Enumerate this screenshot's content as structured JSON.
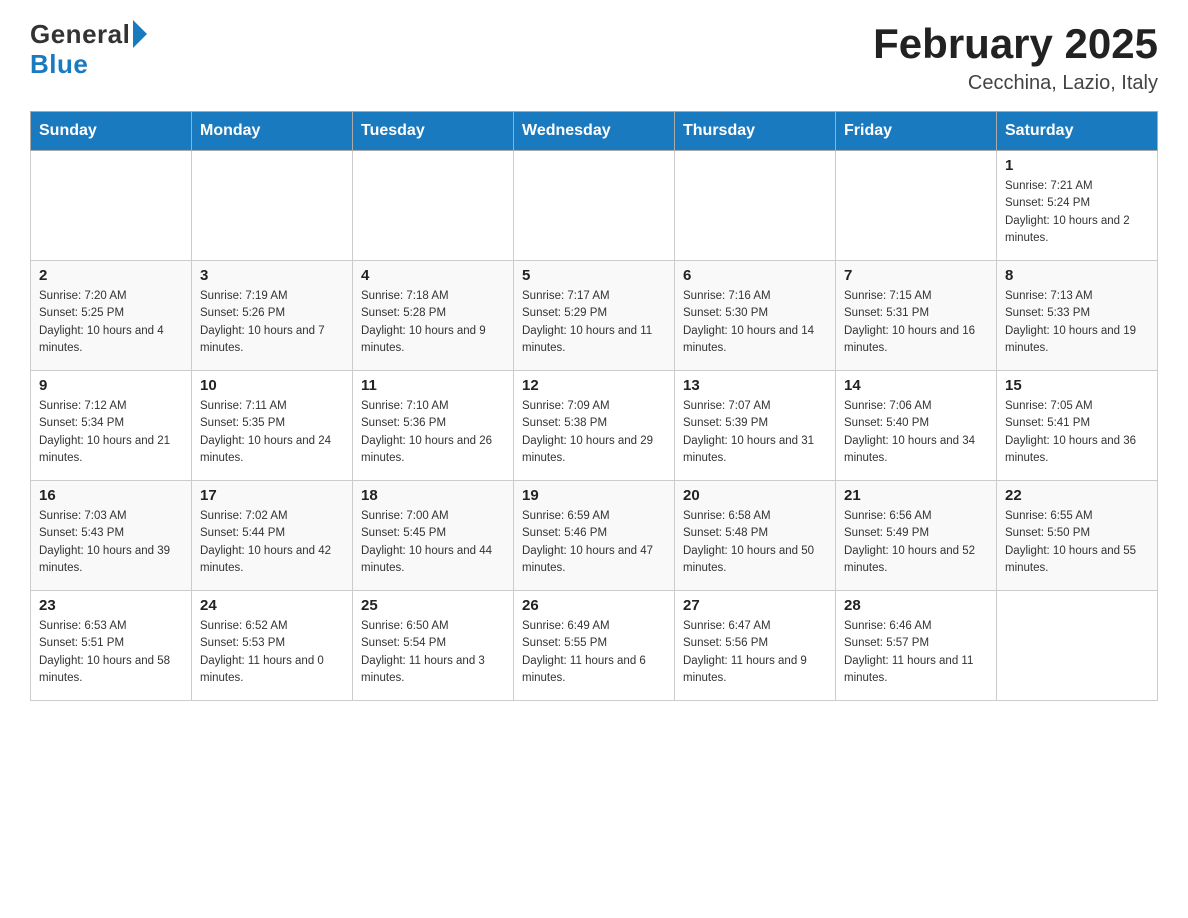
{
  "header": {
    "logo_general": "General",
    "logo_blue": "Blue",
    "month": "February 2025",
    "location": "Cecchina, Lazio, Italy"
  },
  "days_of_week": [
    "Sunday",
    "Monday",
    "Tuesday",
    "Wednesday",
    "Thursday",
    "Friday",
    "Saturday"
  ],
  "weeks": [
    [
      {
        "day": "",
        "sunrise": "",
        "sunset": "",
        "daylight": ""
      },
      {
        "day": "",
        "sunrise": "",
        "sunset": "",
        "daylight": ""
      },
      {
        "day": "",
        "sunrise": "",
        "sunset": "",
        "daylight": ""
      },
      {
        "day": "",
        "sunrise": "",
        "sunset": "",
        "daylight": ""
      },
      {
        "day": "",
        "sunrise": "",
        "sunset": "",
        "daylight": ""
      },
      {
        "day": "",
        "sunrise": "",
        "sunset": "",
        "daylight": ""
      },
      {
        "day": "1",
        "sunrise": "Sunrise: 7:21 AM",
        "sunset": "Sunset: 5:24 PM",
        "daylight": "Daylight: 10 hours and 2 minutes."
      }
    ],
    [
      {
        "day": "2",
        "sunrise": "Sunrise: 7:20 AM",
        "sunset": "Sunset: 5:25 PM",
        "daylight": "Daylight: 10 hours and 4 minutes."
      },
      {
        "day": "3",
        "sunrise": "Sunrise: 7:19 AM",
        "sunset": "Sunset: 5:26 PM",
        "daylight": "Daylight: 10 hours and 7 minutes."
      },
      {
        "day": "4",
        "sunrise": "Sunrise: 7:18 AM",
        "sunset": "Sunset: 5:28 PM",
        "daylight": "Daylight: 10 hours and 9 minutes."
      },
      {
        "day": "5",
        "sunrise": "Sunrise: 7:17 AM",
        "sunset": "Sunset: 5:29 PM",
        "daylight": "Daylight: 10 hours and 11 minutes."
      },
      {
        "day": "6",
        "sunrise": "Sunrise: 7:16 AM",
        "sunset": "Sunset: 5:30 PM",
        "daylight": "Daylight: 10 hours and 14 minutes."
      },
      {
        "day": "7",
        "sunrise": "Sunrise: 7:15 AM",
        "sunset": "Sunset: 5:31 PM",
        "daylight": "Daylight: 10 hours and 16 minutes."
      },
      {
        "day": "8",
        "sunrise": "Sunrise: 7:13 AM",
        "sunset": "Sunset: 5:33 PM",
        "daylight": "Daylight: 10 hours and 19 minutes."
      }
    ],
    [
      {
        "day": "9",
        "sunrise": "Sunrise: 7:12 AM",
        "sunset": "Sunset: 5:34 PM",
        "daylight": "Daylight: 10 hours and 21 minutes."
      },
      {
        "day": "10",
        "sunrise": "Sunrise: 7:11 AM",
        "sunset": "Sunset: 5:35 PM",
        "daylight": "Daylight: 10 hours and 24 minutes."
      },
      {
        "day": "11",
        "sunrise": "Sunrise: 7:10 AM",
        "sunset": "Sunset: 5:36 PM",
        "daylight": "Daylight: 10 hours and 26 minutes."
      },
      {
        "day": "12",
        "sunrise": "Sunrise: 7:09 AM",
        "sunset": "Sunset: 5:38 PM",
        "daylight": "Daylight: 10 hours and 29 minutes."
      },
      {
        "day": "13",
        "sunrise": "Sunrise: 7:07 AM",
        "sunset": "Sunset: 5:39 PM",
        "daylight": "Daylight: 10 hours and 31 minutes."
      },
      {
        "day": "14",
        "sunrise": "Sunrise: 7:06 AM",
        "sunset": "Sunset: 5:40 PM",
        "daylight": "Daylight: 10 hours and 34 minutes."
      },
      {
        "day": "15",
        "sunrise": "Sunrise: 7:05 AM",
        "sunset": "Sunset: 5:41 PM",
        "daylight": "Daylight: 10 hours and 36 minutes."
      }
    ],
    [
      {
        "day": "16",
        "sunrise": "Sunrise: 7:03 AM",
        "sunset": "Sunset: 5:43 PM",
        "daylight": "Daylight: 10 hours and 39 minutes."
      },
      {
        "day": "17",
        "sunrise": "Sunrise: 7:02 AM",
        "sunset": "Sunset: 5:44 PM",
        "daylight": "Daylight: 10 hours and 42 minutes."
      },
      {
        "day": "18",
        "sunrise": "Sunrise: 7:00 AM",
        "sunset": "Sunset: 5:45 PM",
        "daylight": "Daylight: 10 hours and 44 minutes."
      },
      {
        "day": "19",
        "sunrise": "Sunrise: 6:59 AM",
        "sunset": "Sunset: 5:46 PM",
        "daylight": "Daylight: 10 hours and 47 minutes."
      },
      {
        "day": "20",
        "sunrise": "Sunrise: 6:58 AM",
        "sunset": "Sunset: 5:48 PM",
        "daylight": "Daylight: 10 hours and 50 minutes."
      },
      {
        "day": "21",
        "sunrise": "Sunrise: 6:56 AM",
        "sunset": "Sunset: 5:49 PM",
        "daylight": "Daylight: 10 hours and 52 minutes."
      },
      {
        "day": "22",
        "sunrise": "Sunrise: 6:55 AM",
        "sunset": "Sunset: 5:50 PM",
        "daylight": "Daylight: 10 hours and 55 minutes."
      }
    ],
    [
      {
        "day": "23",
        "sunrise": "Sunrise: 6:53 AM",
        "sunset": "Sunset: 5:51 PM",
        "daylight": "Daylight: 10 hours and 58 minutes."
      },
      {
        "day": "24",
        "sunrise": "Sunrise: 6:52 AM",
        "sunset": "Sunset: 5:53 PM",
        "daylight": "Daylight: 11 hours and 0 minutes."
      },
      {
        "day": "25",
        "sunrise": "Sunrise: 6:50 AM",
        "sunset": "Sunset: 5:54 PM",
        "daylight": "Daylight: 11 hours and 3 minutes."
      },
      {
        "day": "26",
        "sunrise": "Sunrise: 6:49 AM",
        "sunset": "Sunset: 5:55 PM",
        "daylight": "Daylight: 11 hours and 6 minutes."
      },
      {
        "day": "27",
        "sunrise": "Sunrise: 6:47 AM",
        "sunset": "Sunset: 5:56 PM",
        "daylight": "Daylight: 11 hours and 9 minutes."
      },
      {
        "day": "28",
        "sunrise": "Sunrise: 6:46 AM",
        "sunset": "Sunset: 5:57 PM",
        "daylight": "Daylight: 11 hours and 11 minutes."
      },
      {
        "day": "",
        "sunrise": "",
        "sunset": "",
        "daylight": ""
      }
    ]
  ]
}
